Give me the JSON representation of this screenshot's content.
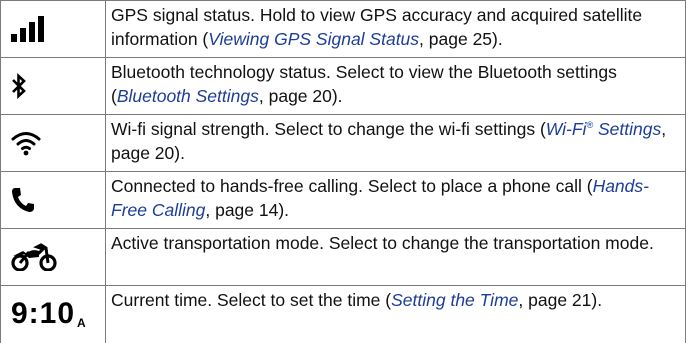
{
  "rows": [
    {
      "icon": "signal-bars-icon",
      "description": "GPS signal status. Hold to view GPS accuracy and acquired satellite information (",
      "link": "Viewing GPS Signal Status",
      "page": ", page 25)."
    },
    {
      "icon": "bluetooth-icon",
      "description": "Bluetooth technology status. Select to view the Bluetooth settings (",
      "link": "Bluetooth Settings",
      "page": ", page 20)."
    },
    {
      "icon": "wifi-icon",
      "description": "Wi-fi signal strength. Select to change the wi-fi settings (",
      "link": "Wi-Fi",
      "link_mark": "®",
      "link_tail": " Settings",
      "page": ", page 20)."
    },
    {
      "icon": "phone-icon",
      "description": "Connected to hands-free calling. Select to place a phone call (",
      "link": "Hands-Free Calling",
      "page": ", page 14)."
    },
    {
      "icon": "motorcycle-icon",
      "description": "Active transportation mode. Select to change the transportation mode."
    },
    {
      "icon": "clock-time-icon",
      "time": "9:10",
      "time_suffix": "A",
      "description": "Current time. Select to set the time (",
      "link": "Setting the Time",
      "page": ", page 21)."
    }
  ],
  "colors": {
    "link": "#1c3d9a",
    "border": "#7a7a7a"
  }
}
